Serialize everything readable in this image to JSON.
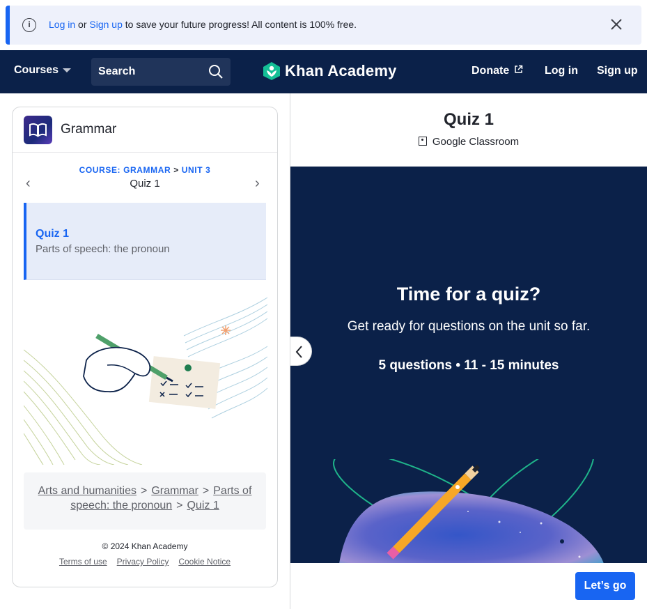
{
  "banner": {
    "login_link": "Log in",
    "or_text": " or ",
    "signup_link": "Sign up",
    "message": " to save your future progress! All content is 100% free.",
    "info_icon": "info-icon",
    "close_icon": "close-icon"
  },
  "header": {
    "courses_label": "Courses",
    "search_placeholder": "Search",
    "logo_text": "Khan Academy",
    "donate_label": "Donate",
    "login_label": "Log in",
    "signup_label": "Sign up",
    "bg_color": "#0b2149"
  },
  "sidebar": {
    "course_title": "Grammar",
    "crumb_course": "COURSE: GRAMMAR",
    "crumb_sep": " > ",
    "crumb_unit": "UNIT 3",
    "unit_item_title": "Quiz 1",
    "active_item": {
      "title": "Quiz 1",
      "subtitle": "Parts of speech: the pronoun"
    },
    "breadcrumb": {
      "arts": "Arts and humanities",
      "grammar": "Grammar",
      "parts": "Parts of speech: the pronoun",
      "quiz": "Quiz 1",
      "sep": ">"
    },
    "copyright": "© 2024 Khan Academy",
    "footer": {
      "terms": "Terms of use",
      "privacy": "Privacy Policy",
      "cookie": "Cookie Notice"
    }
  },
  "main": {
    "title": "Quiz 1",
    "google_classroom": "Google Classroom",
    "heading": "Time for a quiz?",
    "prompt": "Get ready for questions on the unit so far.",
    "meta": "5 questions • 11 - 15 minutes",
    "go_button": "Let’s go",
    "accent_color": "#1865f2"
  }
}
